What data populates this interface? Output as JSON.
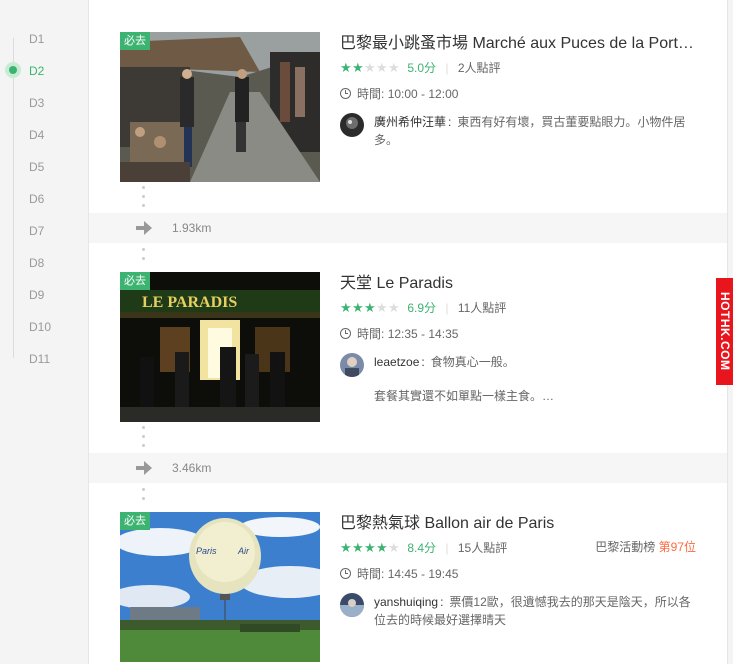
{
  "days": [
    "D1",
    "D2",
    "D3",
    "D4",
    "D5",
    "D6",
    "D7",
    "D8",
    "D9",
    "D10",
    "D11"
  ],
  "active_day": "D2",
  "pois": [
    {
      "badge": "必去",
      "title": "巴黎最小跳蚤市場 Marché aux Puces de la Port…",
      "stars": 2,
      "score": "5.0分",
      "reviews": "2人點評",
      "time_label": "時間:",
      "time": "10:00 - 12:00",
      "comment_user": "廣州希仲汪華",
      "comment_colon": ":",
      "comment_text": "東西有好有壞，買古董要點眼力。小物件居多。"
    },
    {
      "badge": "必去",
      "title": "天堂 Le Paradis",
      "stars": 3,
      "score": "6.9分",
      "reviews": "11人點評",
      "time_label": "時間:",
      "time": "12:35 - 14:35",
      "comment_user": "leaetzoe",
      "comment_colon": ":",
      "comment_text": "食物真心一般。",
      "comment_text2": "套餐其實還不如單點一樣主食。…"
    },
    {
      "badge": "必去",
      "title": "巴黎熱氣球 Ballon air de Paris",
      "stars": 4,
      "score": "8.4分",
      "reviews": "15人點評",
      "rank_label": "巴黎活動榜",
      "rank_value": "第97位",
      "time_label": "時間:",
      "time": "14:45 - 19:45",
      "comment_user": "yanshuiqing",
      "comment_colon": ":",
      "comment_text": "票價12歐，很遺憾我去的那天是陰天，所以各位去的時候最好選擇晴天"
    }
  ],
  "distances": [
    "1.93km",
    "3.46km"
  ],
  "side_tag": "HOTHK.COM",
  "colors": {
    "accent_green": "#3cb371",
    "rank_orange": "#ff6a3d",
    "tag_red": "#e8151c"
  },
  "icons": {
    "clock": "clock-icon",
    "arrow": "arrow-right-icon",
    "star": "star-icon"
  }
}
